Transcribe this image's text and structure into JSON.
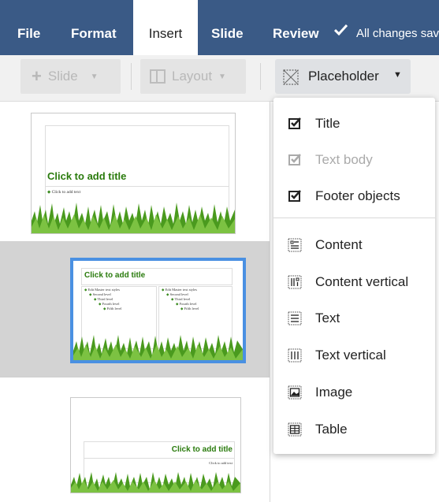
{
  "menubar": {
    "items": [
      "File",
      "Format",
      "Insert",
      "Slide",
      "Review"
    ],
    "active": "Insert",
    "save_status": "All changes saved"
  },
  "toolbar": {
    "slide_label": "Slide",
    "layout_label": "Layout",
    "placeholder_label": "Placeholder"
  },
  "slides": {
    "title": "Click to add title",
    "text": "Click to add text",
    "master_l1": "Edit Master text styles",
    "master_l2": "Second level",
    "master_l3": "Third level",
    "master_l4": "Fourth level",
    "master_l5": "Fifth level"
  },
  "placeholder_menu": {
    "toggles": [
      {
        "label": "Title",
        "checked": true,
        "enabled": true
      },
      {
        "label": "Text body",
        "checked": true,
        "enabled": false
      },
      {
        "label": "Footer objects",
        "checked": true,
        "enabled": true
      }
    ],
    "items": [
      {
        "label": "Content",
        "icon": "content-icon"
      },
      {
        "label": "Content vertical",
        "icon": "content-vertical-icon"
      },
      {
        "label": "Text",
        "icon": "text-icon"
      },
      {
        "label": "Text vertical",
        "icon": "text-vertical-icon"
      },
      {
        "label": "Image",
        "icon": "image-icon"
      },
      {
        "label": "Table",
        "icon": "table-icon"
      }
    ]
  },
  "colors": {
    "menubar_bg": "#3a5a86",
    "title_green": "#2a7b0d",
    "selection_border": "#4a90e2"
  }
}
